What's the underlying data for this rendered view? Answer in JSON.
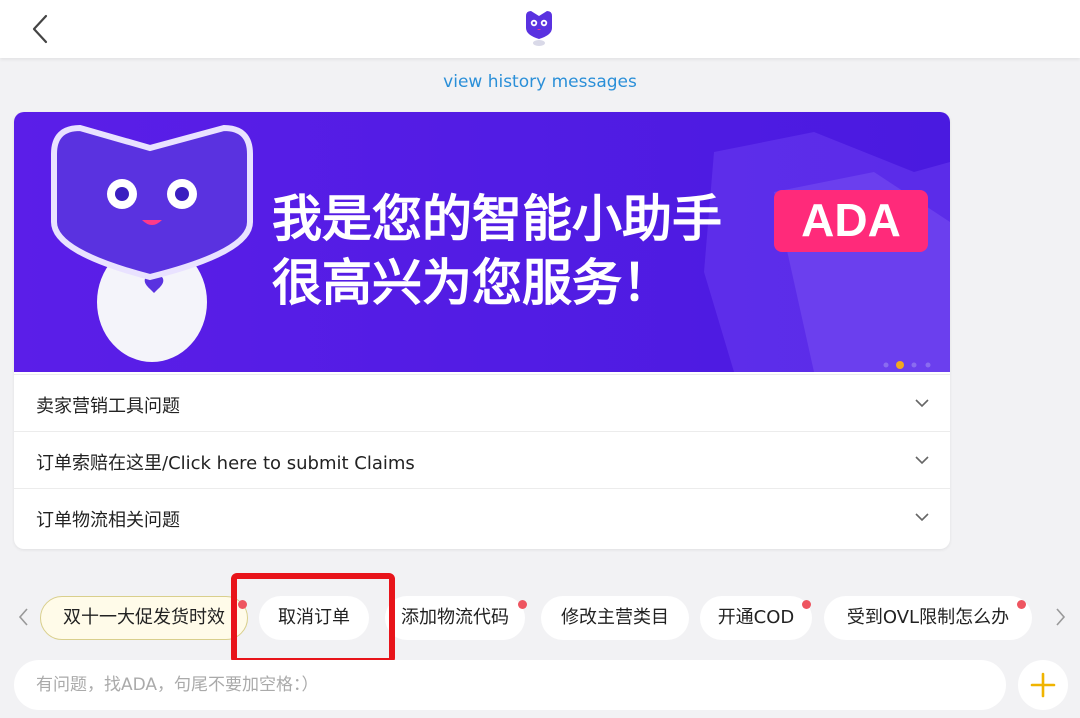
{
  "header": {
    "back_icon": "chevron-left-icon",
    "logo_icon": "ada-robot-logo-icon"
  },
  "history_link": "view history messages",
  "banner": {
    "line1": "我是您的智能小助手",
    "badge": "ADA",
    "line2": "很高兴为您服务！",
    "slide_indicator": {
      "total": 4,
      "active_index": 1
    }
  },
  "faq": [
    {
      "label": "卖家营销工具问题"
    },
    {
      "label": "订单索赔在这里/Click here to submit Claims"
    },
    {
      "label": "订单物流相关问题"
    }
  ],
  "chips": [
    {
      "label": "双十一大促发货时效",
      "dot": true,
      "highlight": true
    },
    {
      "label": "取消订单",
      "dot": false
    },
    {
      "label": "添加物流代码",
      "dot": true
    },
    {
      "label": "修改主营类目",
      "dot": false
    },
    {
      "label": "开通COD",
      "dot": true
    },
    {
      "label": "受到OVL限制怎么办",
      "dot": true
    }
  ],
  "input": {
    "placeholder": "有问题，找ADA，句尾不要加空格：）"
  },
  "colors": {
    "banner_purple": "#5a1ee8",
    "badge_pink": "#ff2a7a",
    "link_blue": "#2a8fd8",
    "plus_yellow": "#f0b400",
    "notification_dot": "#ee5560",
    "annotation_red": "#e8141a"
  }
}
